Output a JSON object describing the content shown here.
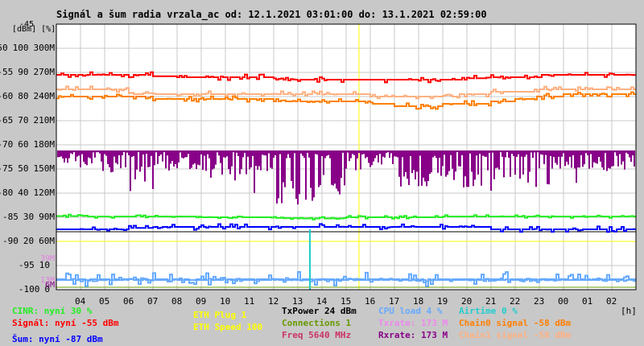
{
  "chart_data": {
    "type": "line",
    "title": "Signál a šum radia vrzala_ac od: 12.1.2021 03:01:00 do: 13.1.2021 02:59:00",
    "y_unit_labels": "[dBm] [%]",
    "y_top_label": "-45",
    "xlabel": "[h]",
    "x_ticks": [
      "04",
      "05",
      "06",
      "07",
      "08",
      "09",
      "10",
      "11",
      "12",
      "13",
      "14",
      "15",
      "16",
      "17",
      "18",
      "19",
      "20",
      "21",
      "22",
      "23",
      "00",
      "01",
      "02"
    ],
    "y_ticks": [
      {
        "dbm": "-50",
        "pct": "100",
        "rate": "300M"
      },
      {
        "dbm": "-55",
        "pct": "90",
        "rate": "270M"
      },
      {
        "dbm": "-60",
        "pct": "80",
        "rate": "240M"
      },
      {
        "dbm": "-65",
        "pct": "70",
        "rate": "210M"
      },
      {
        "dbm": "-70",
        "pct": "60",
        "rate": "180M"
      },
      {
        "dbm": "-75",
        "pct": "50",
        "rate": "150M"
      },
      {
        "dbm": "-80",
        "pct": "40",
        "rate": "120M"
      },
      {
        "dbm": "-85",
        "pct": "30",
        "rate": "90M"
      },
      {
        "dbm": "-90",
        "pct": "20",
        "rate": "60M"
      },
      {
        "dbm": "-95",
        "pct": "10",
        "rate": ""
      },
      {
        "dbm": "-100",
        "pct": "0",
        "rate": ""
      }
    ],
    "extra_rate_labels": [
      {
        "text": "39M",
        "color": "#e080e0"
      },
      {
        "text": "13M",
        "color": "#e080e0"
      },
      {
        "text": "6M",
        "color": "#880088"
      }
    ],
    "ylim_dbm": [
      -100,
      -45
    ],
    "x_hours_from": 3,
    "series": [
      {
        "name": "Signál",
        "unit": "dBm",
        "color": "#ff0000",
        "values": [
          -55.5,
          -55.5,
          -55.5,
          -55.5,
          -55.8,
          -56,
          -56,
          -56,
          -56,
          -56.5,
          -56.5,
          -56.5,
          -56.5,
          -56.5,
          -56.5,
          -56.5,
          -56.5,
          -56.2,
          -56,
          -56,
          -55.5,
          -55.5,
          -55.5,
          -55.5
        ]
      },
      {
        "name": "Chain1 signal",
        "unit": "dBm",
        "color": "#ffb080",
        "values": [
          -58.5,
          -58.5,
          -58.5,
          -59.5,
          -59.5,
          -59.5,
          -59.5,
          -59.5,
          -59.5,
          -59.5,
          -59.5,
          -59.5,
          -59.5,
          -60,
          -60,
          -60,
          -60,
          -59.5,
          -59,
          -59,
          -58.5,
          -58.5,
          -58.5,
          -58.5
        ]
      },
      {
        "name": "Chain0 signal",
        "unit": "dBm",
        "color": "#ff8000",
        "values": [
          -60,
          -60,
          -60,
          -60,
          -60.5,
          -60.5,
          -60.5,
          -60.5,
          -60.5,
          -61,
          -61,
          -61,
          -61,
          -61.5,
          -62,
          -62,
          -61.5,
          -61.5,
          -61,
          -60.5,
          -60,
          -59.5,
          -59.5,
          -59.5
        ]
      },
      {
        "name": "CINR",
        "unit": "%",
        "color": "#22ee22",
        "values": [
          30.5,
          30.3,
          30.3,
          30.3,
          30.3,
          30.3,
          30,
          30,
          30,
          29.7,
          29.5,
          29.5,
          30,
          30,
          30,
          30,
          30.3,
          30.3,
          30.3,
          30.3,
          30.3,
          30.3,
          30.3,
          30.3
        ]
      },
      {
        "name": "Šum",
        "unit": "dBm",
        "color": "#0000ff",
        "values": [
          -87.5,
          -87.5,
          -87.5,
          -87.2,
          -87,
          -87,
          -87,
          -87,
          -87,
          -87,
          -87,
          -87,
          -87,
          -87,
          -87,
          -87,
          -87,
          -87,
          -87.5,
          -87.5,
          -87.5,
          -87.5,
          -87.5,
          -87.5
        ]
      },
      {
        "name": "Rxrate",
        "unit": "M",
        "color": "#880088",
        "values": [
          165,
          160,
          158,
          155,
          160,
          160,
          158,
          158,
          160,
          140,
          135,
          145,
          160,
          160,
          150,
          150,
          155,
          150,
          155,
          150,
          160,
          160,
          160,
          160
        ]
      },
      {
        "name": "CPU load",
        "unit": "%",
        "color": "#66aaff",
        "values": [
          4,
          4,
          4,
          4,
          4,
          4,
          4,
          4,
          4,
          4,
          4,
          4,
          4,
          4,
          4,
          4,
          4,
          4,
          4,
          4,
          4,
          4,
          4,
          4
        ]
      },
      {
        "name": "Txrate",
        "unit": "M",
        "color": "#66aaff",
        "values": [
          13,
          13,
          13,
          13,
          13,
          13,
          13,
          13,
          13,
          13,
          13,
          13,
          13,
          13,
          13,
          13,
          13,
          13,
          13,
          13,
          13,
          13,
          13,
          13
        ]
      }
    ],
    "legend": [
      {
        "label": "CINR: nyní 30 %",
        "color": "#22ee22"
      },
      {
        "label": "Signál: nyní -55 dBm",
        "color": "#ff0000"
      },
      {
        "label": "Šum: nyní -87 dBm",
        "color": "#0000ff"
      },
      {
        "label": "ETH Plug 1",
        "color": "#ffff00"
      },
      {
        "label": "ETH Speed 100",
        "color": "#ffff00"
      },
      {
        "label": "TxPower 24 dBm",
        "color": "#000000"
      },
      {
        "label": "Connections 1",
        "color": "#669900"
      },
      {
        "label": "Freq 5640 MHz",
        "color": "#cc3366"
      },
      {
        "label": "CPU load 4 %",
        "color": "#66aaff"
      },
      {
        "label": "Txrate: 173 M",
        "color": "#ee88ee"
      },
      {
        "label": "Rxrate: 173 M",
        "color": "#880088"
      },
      {
        "label": "Airtime 0 %",
        "color": "#22cccc"
      },
      {
        "label": "Chain0 signal -58 dBm",
        "color": "#ff8000"
      },
      {
        "label": "Chain1 signal -58 dBm",
        "color": "#ffb080"
      }
    ]
  }
}
